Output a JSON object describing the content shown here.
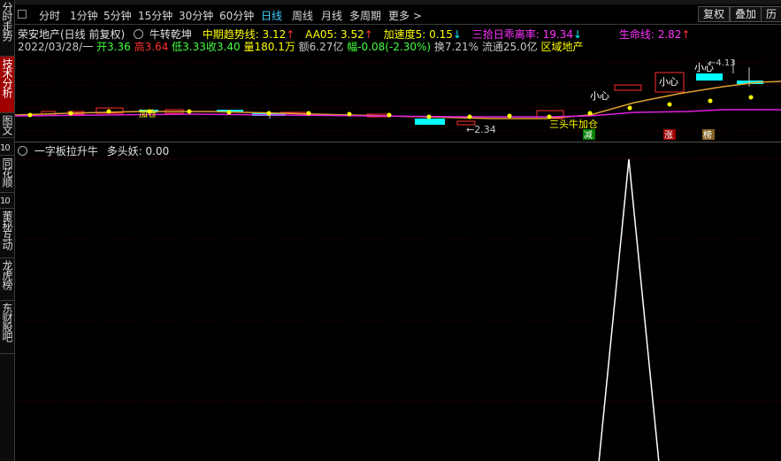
{
  "sidebar": {
    "tabs": [
      {
        "label": "分时走势",
        "active": false
      },
      {
        "label": "技术分析",
        "active": true
      },
      {
        "label": "图文",
        "active": false
      },
      {
        "label": "10",
        "active": false
      },
      {
        "label": "同花顺",
        "active": false
      },
      {
        "label": "10",
        "active": false
      },
      {
        "label": "董秘互动",
        "active": false
      },
      {
        "label": "龙虎榜",
        "active": false
      },
      {
        "label": "东财股吧",
        "active": false
      }
    ]
  },
  "toolbar": {
    "periods": [
      "分时",
      "1分钟",
      "5分钟",
      "15分钟",
      "30分钟",
      "60分钟",
      "日线",
      "周线",
      "月线",
      "多周期",
      "更多 >"
    ],
    "active_period": "日线",
    "right_buttons": [
      "复权",
      "叠加",
      "历史"
    ]
  },
  "main_chart": {
    "stock_title": "荣安地产(日线 前复权)",
    "indicator_name": "牛转乾坤",
    "indicators": [
      {
        "label": "中期趋势线: 3.12",
        "arrow": "↑",
        "color": "#ffff00"
      },
      {
        "label": "AA05: 3.52",
        "arrow": "↑",
        "color": "#ffff00"
      },
      {
        "label": "加速度5: 0.15",
        "arrow": "↓",
        "color": "#ffff00"
      },
      {
        "label": "三拾日乖离率: 19.34",
        "arrow": "↓",
        "color": "#ff33ff"
      },
      {
        "label": "生命线: 2.82",
        "arrow": "↑",
        "color": "#ff33ff"
      }
    ],
    "quote": {
      "date": "2022/03/28/一",
      "open": "开3.36",
      "high": "高3.64",
      "low": "低3.33",
      "close": "收3.40",
      "volume": "量180.1万",
      "amount": "额6.27亿",
      "change": "幅-0.08(-2.30%)",
      "turnover": "换7.21%",
      "float": "流通25.0亿",
      "sector": "区域地产"
    },
    "annotations": {
      "low_price": "←2.34",
      "high_price": "←4.13",
      "caution1": "小心",
      "caution2": "小心",
      "caution3": "小心",
      "add_pos1": "加仓",
      "add_pos2": "三头牛加仓",
      "reduce": "减",
      "rise": "涨",
      "board": "榜"
    },
    "colors": {
      "up": "#ff3030",
      "down": "#00ffff",
      "ma_orange": "#e0a030",
      "ma_magenta": "#e020e0",
      "dot": "#ffff00"
    }
  },
  "sub_chart": {
    "title": "一字板拉升牛",
    "value_label": "多头妖: 0.00",
    "chart_data": {
      "type": "line",
      "series": [
        {
          "values": [
            0,
            0,
            0,
            0,
            0,
            0,
            0,
            0,
            0,
            0,
            0,
            0,
            1,
            0,
            0
          ]
        }
      ]
    }
  }
}
